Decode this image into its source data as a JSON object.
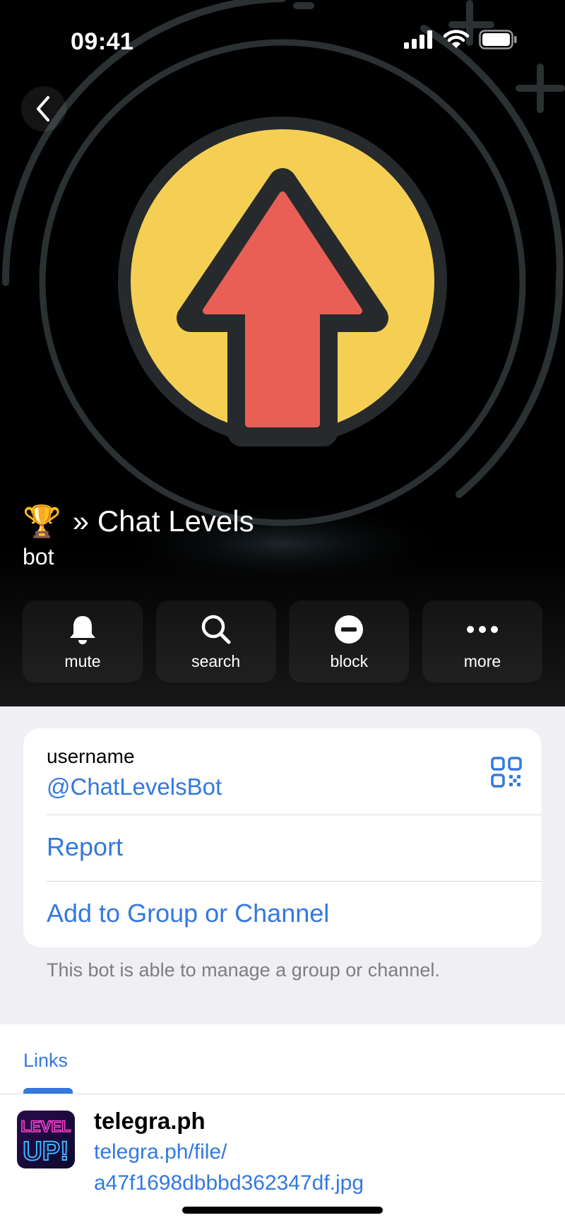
{
  "status_bar": {
    "time": "09:41"
  },
  "header": {
    "emoji": "🏆",
    "title": "» Chat Levels",
    "subtitle": "bot"
  },
  "actions": [
    {
      "label": "mute",
      "icon": "bell-icon"
    },
    {
      "label": "search",
      "icon": "search-icon"
    },
    {
      "label": "block",
      "icon": "block-icon"
    },
    {
      "label": "more",
      "icon": "more-icon"
    }
  ],
  "info": {
    "username_label": "username",
    "username_value": "@ChatLevelsBot",
    "report_label": "Report",
    "add_label": "Add to Group or Channel",
    "footnote": "This bot is able to manage a group or channel."
  },
  "links": {
    "tab_label": "Links",
    "items": [
      {
        "title": "telegra.ph",
        "url_line1": "telegra.ph/file/",
        "url_line2": "a47f1698dbbbd362347df.jpg",
        "thumb_text_top": "LEVEL",
        "thumb_text_bottom": "UP!"
      }
    ]
  },
  "colors": {
    "accent": "#3478e0",
    "avatar_yellow": "#f5cf54",
    "avatar_arrow": "#ea5f55",
    "background": "#efeff4"
  }
}
